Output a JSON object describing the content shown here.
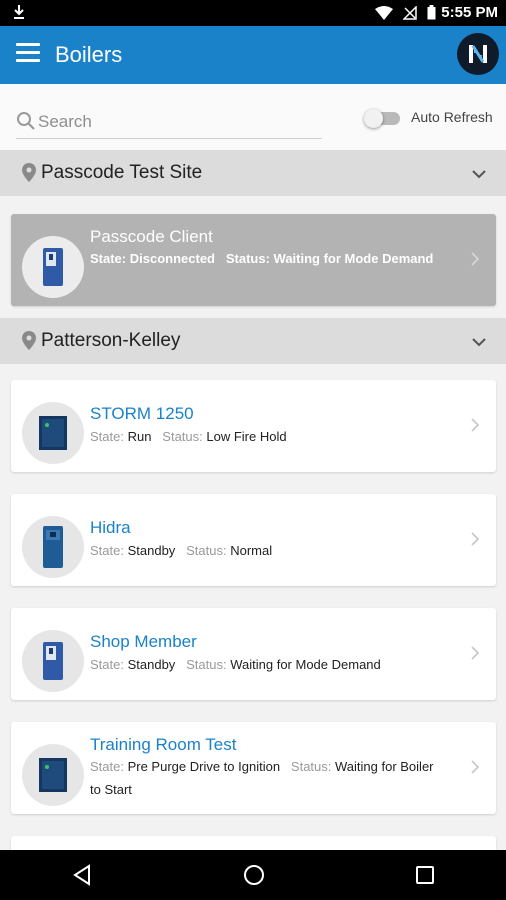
{
  "status_bar": {
    "time": "5:55 PM"
  },
  "header": {
    "title": "Boilers"
  },
  "search": {
    "placeholder": "Search"
  },
  "auto_refresh": {
    "label": "Auto Refresh",
    "enabled": false
  },
  "labels": {
    "state": "State:",
    "status": "Status:"
  },
  "groups": [
    {
      "name": "Passcode Test Site",
      "devices": [
        {
          "name": "Passcode Client",
          "state": "Disconnected",
          "status": "Waiting for Mode Demand",
          "disabled": true
        }
      ]
    },
    {
      "name": "Patterson-Kelley",
      "devices": [
        {
          "name": "STORM 1250",
          "state": "Run",
          "status": "Low Fire Hold",
          "disabled": false
        },
        {
          "name": "Hidra",
          "state": "Standby",
          "status": "Normal",
          "disabled": false
        },
        {
          "name": "Shop Member",
          "state": "Standby",
          "status": "Waiting for Mode Demand",
          "disabled": false
        },
        {
          "name": "Training Room Test",
          "state": "Pre Purge Drive to Ignition",
          "status": "Waiting for Boiler to Start",
          "disabled": false
        }
      ]
    }
  ],
  "colors": {
    "accent": "#1a82c8",
    "group_header": "#dcdcdc",
    "disabled_card": "#b3b3b3"
  }
}
